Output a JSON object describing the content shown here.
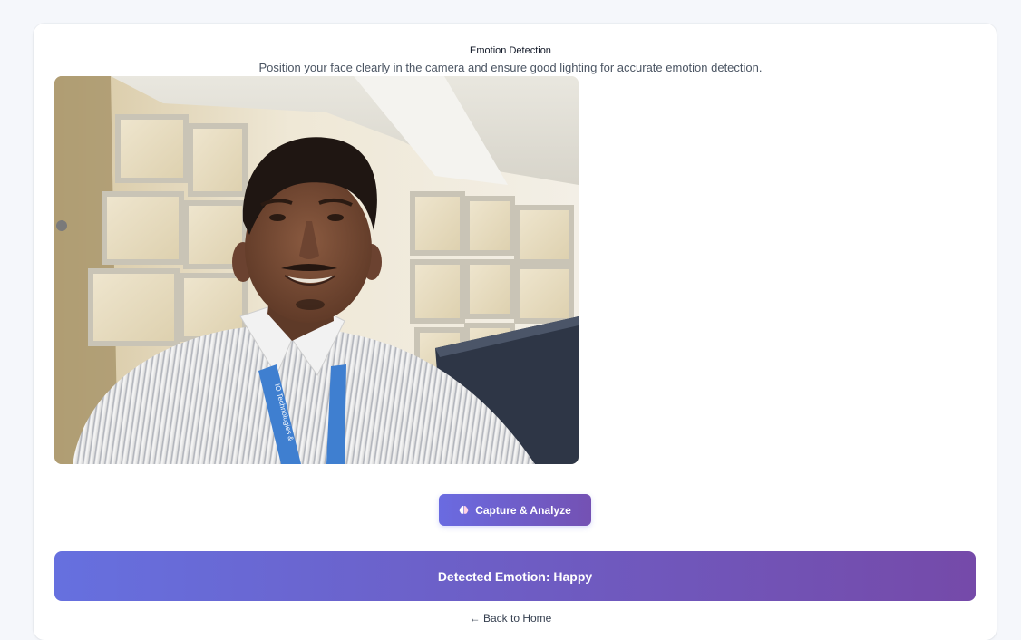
{
  "header": {
    "title": "Emotion Detection",
    "subtitle": "Position your face clearly in the camera and ensure good lighting for accurate emotion detection."
  },
  "camera": {
    "badge_text": "IO Technologies & "
  },
  "capture_button": {
    "label": "Capture & Analyze",
    "icon": "brain-icon"
  },
  "result": {
    "text": "Detected Emotion: Happy"
  },
  "navigation": {
    "back_label": "← Back to Home"
  },
  "colors": {
    "background": "#f5f7fb",
    "accent_start": "#6670df",
    "accent_end": "#754aa9"
  }
}
